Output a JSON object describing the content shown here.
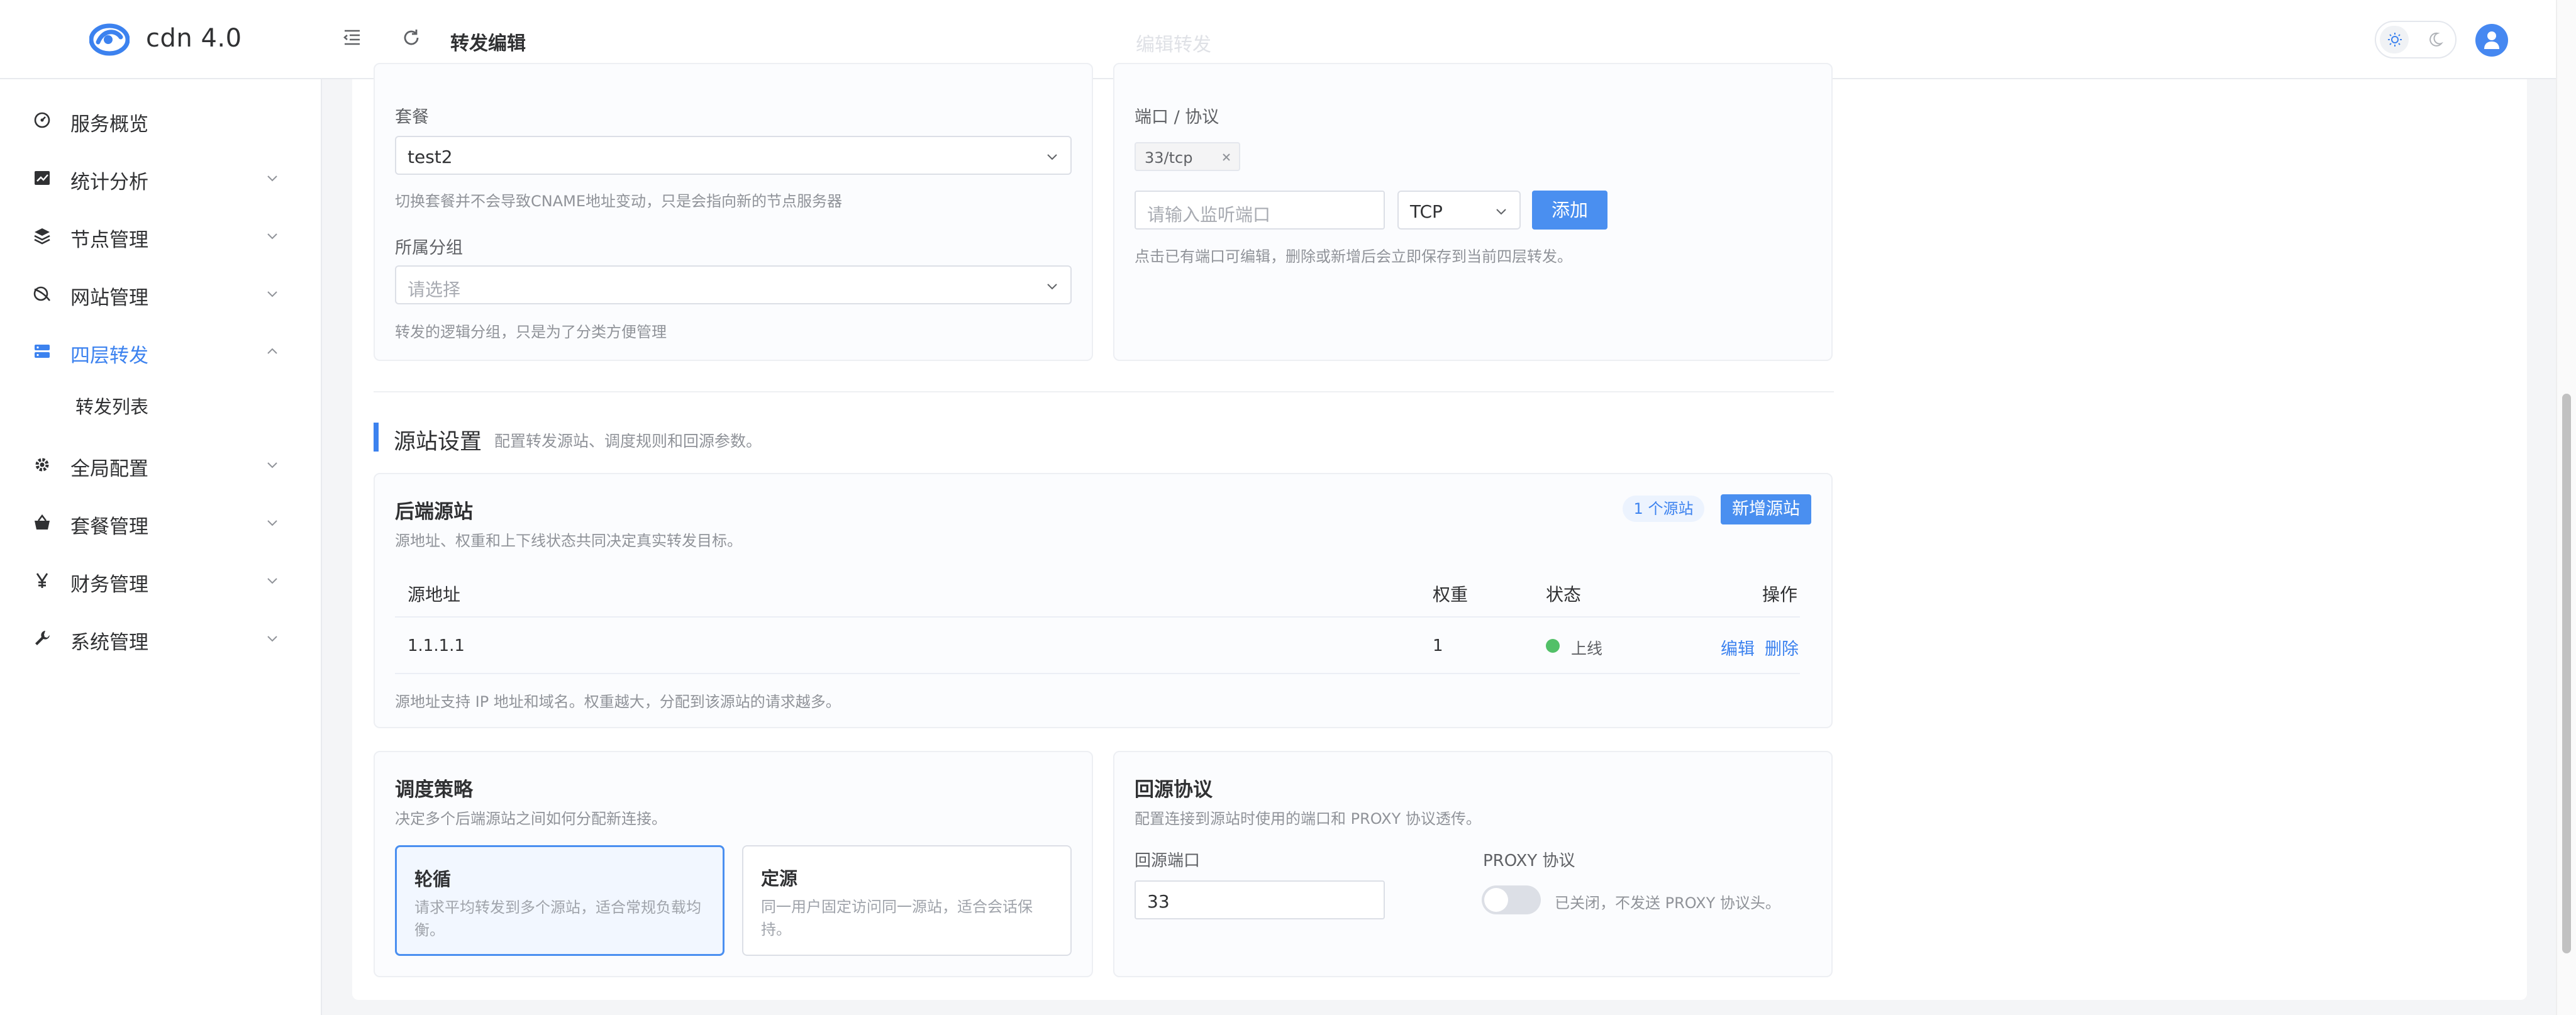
{
  "header": {
    "brand": "cdn 4.0",
    "breadcrumb": "转发编辑",
    "ghost_title": "编辑转发"
  },
  "sidebar": {
    "items": [
      {
        "label": "服务概览",
        "icon": "dashboard-icon"
      },
      {
        "label": "统计分析",
        "icon": "chart-icon"
      },
      {
        "label": "节点管理",
        "icon": "layers-icon"
      },
      {
        "label": "网站管理",
        "icon": "globe-icon"
      },
      {
        "label": "四层转发",
        "icon": "server-icon",
        "active": true
      },
      {
        "label": "全局配置",
        "icon": "gear-icon"
      },
      {
        "label": "套餐管理",
        "icon": "basket-icon"
      },
      {
        "label": "财务管理",
        "icon": "yen-icon"
      },
      {
        "label": "系统管理",
        "icon": "wrench-icon"
      }
    ],
    "sub_items": [
      {
        "label": "转发列表"
      }
    ]
  },
  "form": {
    "plan_label": "套餐",
    "plan_value": "test2",
    "plan_hint": "切换套餐并不会导致CNAME地址变动，只是会指向新的节点服务器",
    "group_label": "所属分组",
    "group_placeholder": "请选择",
    "group_hint": "转发的逻辑分组，只是为了分类方便管理",
    "port_label": "端口 / 协议",
    "port_tag": "33/tcp",
    "port_input_placeholder": "请输入监听端口",
    "protocol_value": "TCP",
    "add_label": "添加",
    "port_hint": "点击已有端口可编辑，删除或新增后会立即保存到当前四层转发。"
  },
  "origin_section": {
    "title": "源站设置",
    "desc": "配置转发源站、调度规则和回源参数。"
  },
  "backend": {
    "title": "后端源站",
    "desc": "源地址、权重和上下线状态共同决定真实转发目标。",
    "count_badge": "1 个源站",
    "add_button": "新增源站",
    "columns": {
      "address": "源地址",
      "weight": "权重",
      "status": "状态",
      "actions": "操作"
    },
    "rows": [
      {
        "address": "1.1.1.1",
        "weight": "1",
        "status": "上线",
        "edit": "编辑",
        "delete": "删除"
      }
    ],
    "hint": "源地址支持 IP 地址和域名。权重越大，分配到该源站的请求越多。",
    "status_color": "#52c068"
  },
  "schedule": {
    "title": "调度策略",
    "desc": "决定多个后端源站之间如何分配新连接。",
    "options": [
      {
        "title": "轮循",
        "desc": "请求平均转发到多个源站，适合常规负载均衡。",
        "selected": true
      },
      {
        "title": "定源",
        "desc": "同一用户固定访问同一源站，适合会话保持。",
        "selected": false
      }
    ]
  },
  "back_to_origin": {
    "title": "回源协议",
    "desc": "配置连接到源站时使用的端口和 PROXY 协议透传。",
    "port_label": "回源端口",
    "port_value": "33",
    "proxy_label": "PROXY 协议",
    "proxy_status": "已关闭，不发送 PROXY 协议头。",
    "proxy_enabled": false
  },
  "colors": {
    "accent": "#3c82ef",
    "primary_button": "#4a8ff0"
  }
}
